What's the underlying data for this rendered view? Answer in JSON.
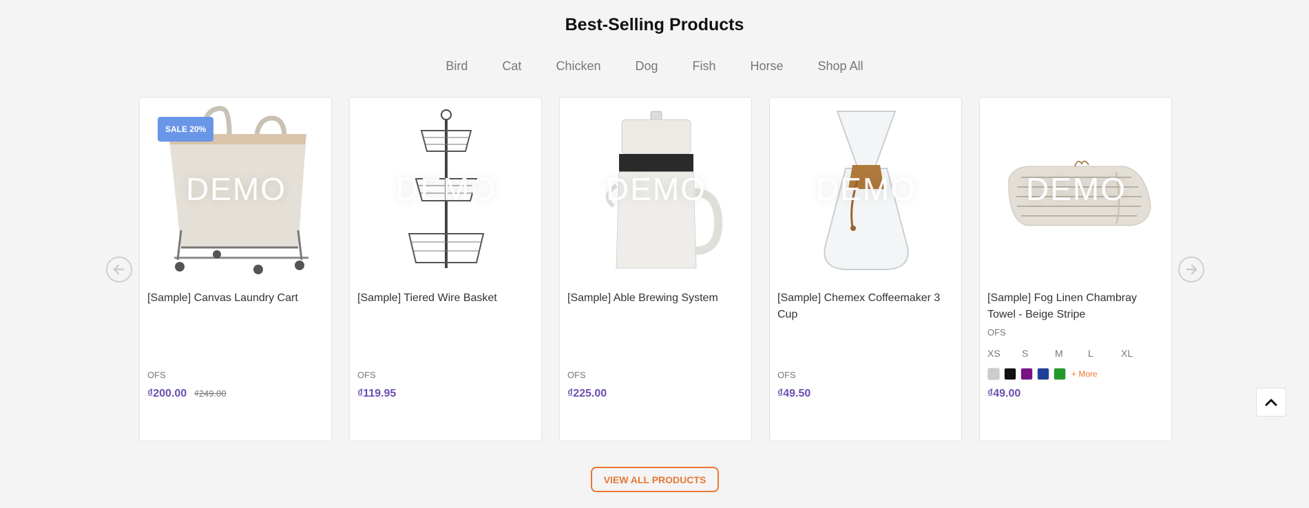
{
  "section": {
    "title": "Best-Selling Products"
  },
  "tabs": [
    "Bird",
    "Cat",
    "Chicken",
    "Dog",
    "Fish",
    "Horse",
    "Shop All"
  ],
  "overlay_text": "DEMO",
  "products": [
    {
      "name": "[Sample] Canvas Laundry Cart",
      "brand": "OFS",
      "price": "₫200.00",
      "old_price": "₫249.00",
      "badge": "SALE 20%"
    },
    {
      "name": "[Sample] Tiered Wire Basket",
      "brand": "OFS",
      "price": "₫119.95"
    },
    {
      "name": "[Sample] Able Brewing System",
      "brand": "OFS",
      "price": "₫225.00"
    },
    {
      "name": "[Sample] Chemex Coffeemaker 3 Cup",
      "brand": "OFS",
      "price": "₫49.50"
    },
    {
      "name": "[Sample] Fog Linen Chambray Towel - Beige Stripe",
      "brand": "OFS",
      "price": "₫49.00",
      "sizes": [
        "XS",
        "S",
        "M",
        "L",
        "XL"
      ],
      "swatches": [
        "#cccccc",
        "#111111",
        "#7a1287",
        "#1f3f9a",
        "#1f9a2a"
      ],
      "more_label": "+ More"
    }
  ],
  "view_all_label": "VIEW ALL PRODUCTS",
  "colors": {
    "accent": "#e97732",
    "price": "#6b4fb0",
    "badge": "#6a96e8"
  }
}
